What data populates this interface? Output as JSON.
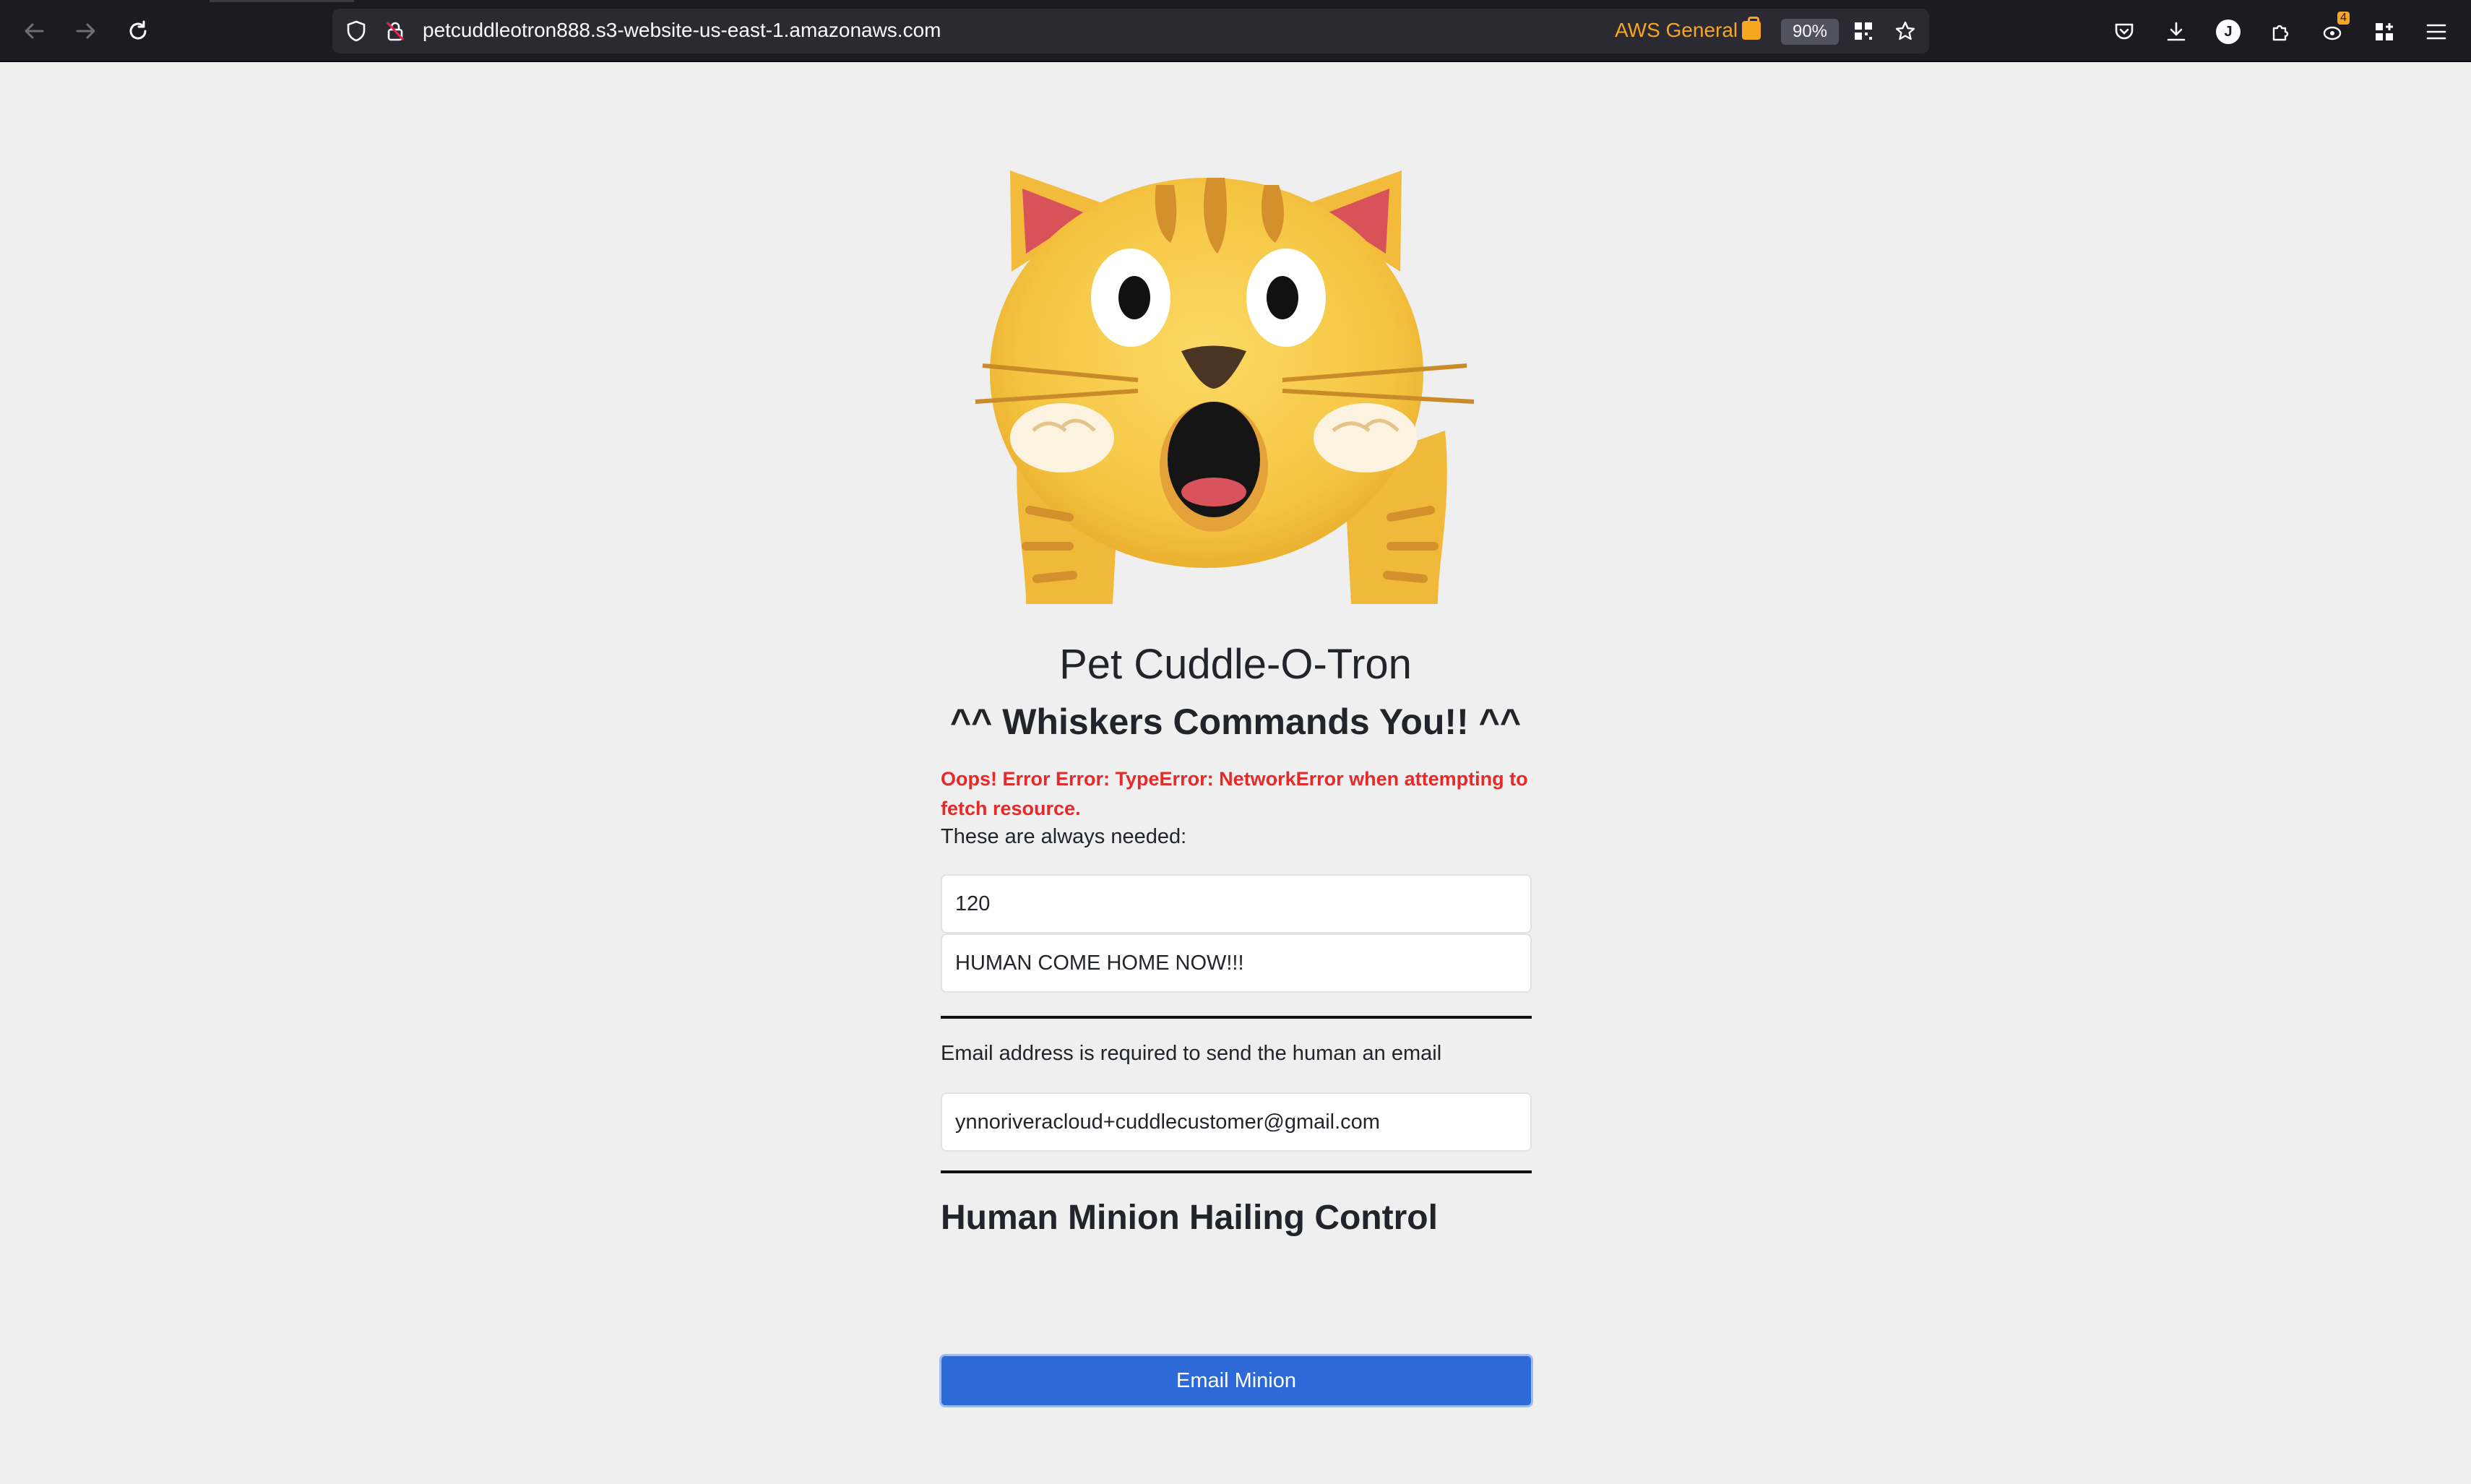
{
  "browser": {
    "url": "petcuddleotron888.s3-website-us-east-1.amazonaws.com",
    "container_label": "AWS General",
    "zoom": "90%",
    "profile_initial": "J",
    "extension_badge": "4"
  },
  "page": {
    "title": "Pet Cuddle-O-Tron",
    "subtitle": "^^ Whiskers Commands You!! ^^",
    "error": "Oops! Error Error: TypeError: NetworkError when attempting to fetch resource.",
    "always_needed": "These are always needed:",
    "delay_value": "120",
    "message_value": "HUMAN COME HOME NOW!!!",
    "email_note": "Email address is required to send the human an email",
    "email_value": "ynnoriveracloud+cuddlecustomer@gmail.com",
    "control_heading": "Human Minion Hailing Control",
    "email_button": "Email Minion"
  }
}
